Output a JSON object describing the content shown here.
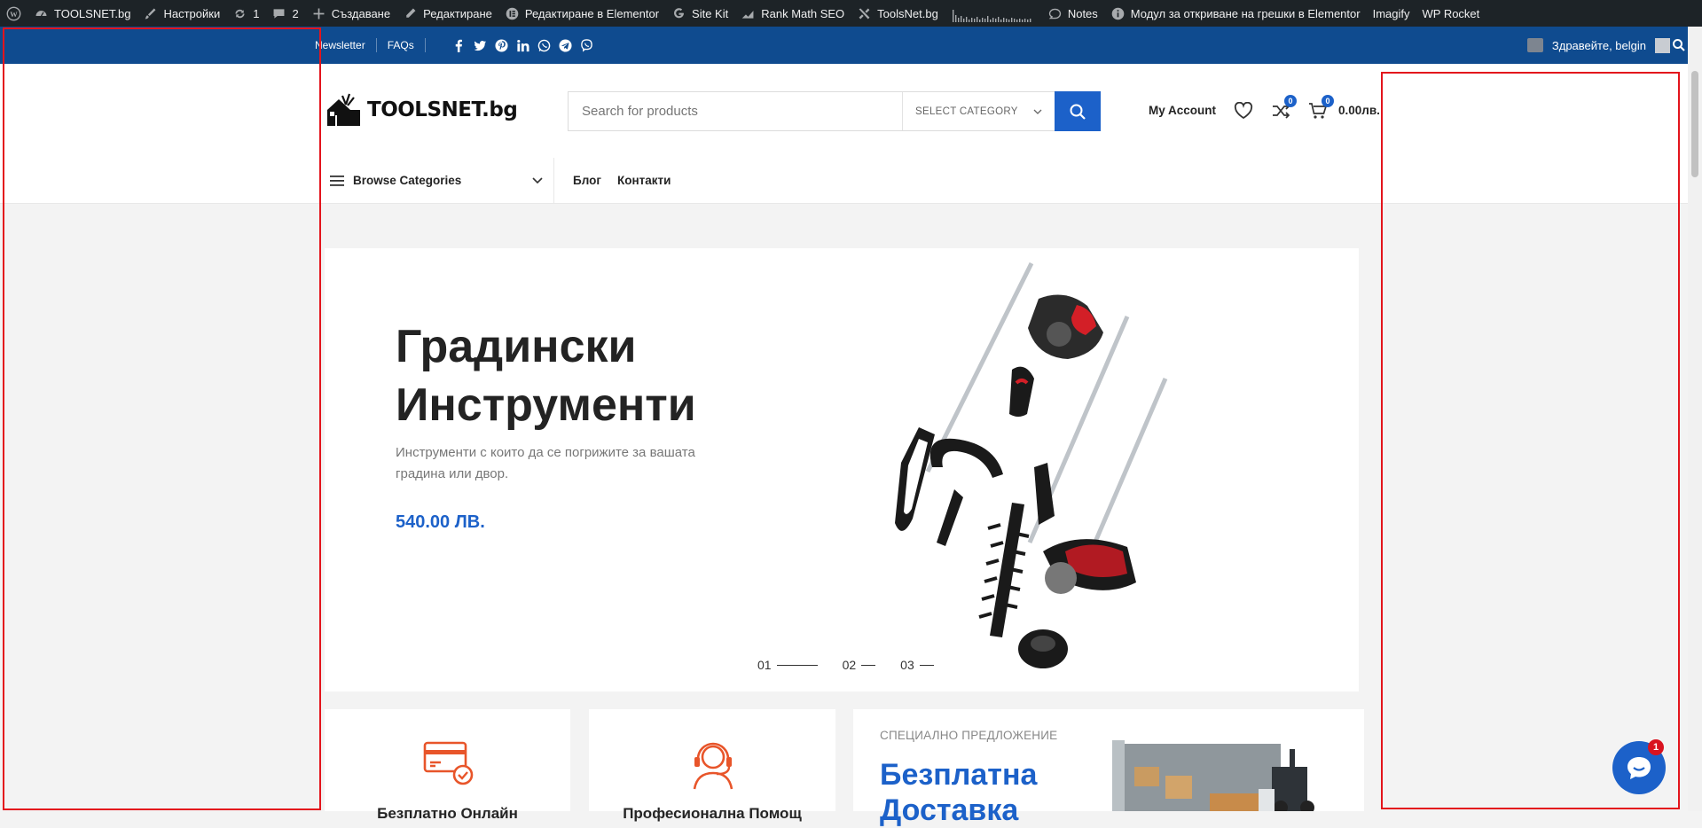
{
  "adminbar": {
    "site_name": "TOOLSNET.bg",
    "settings": "Настройки",
    "updates_count": "1",
    "comments_count": "2",
    "new": "Създаване",
    "edit": "Редактиране",
    "edit_elementor": "Редактиране в Elementor",
    "site_kit": "Site Kit",
    "rank_math": "Rank Math SEO",
    "toolsnet": "ToolsNet.bg",
    "notes": "Notes",
    "debug_mode": "Модул за откриване на грешки в Elementor",
    "imagify": "Imagify",
    "wp_rocket": "WP Rocket"
  },
  "topbar": {
    "newsletter": "Newsletter",
    "faqs": "FAQs",
    "social": [
      "facebook-icon",
      "twitter-icon",
      "pinterest-icon",
      "linkedin-icon",
      "whatsapp-icon",
      "telegram-icon",
      "viber-icon"
    ],
    "howdy": "Здравейте, belgin"
  },
  "header": {
    "logo_text": "TOOLSNET.bg",
    "search_placeholder": "Search for products",
    "category_label": "SELECT CATEGORY",
    "account": "My Account",
    "compare_count": "0",
    "cart_count": "0",
    "cart_total": "0.00лв."
  },
  "nav": {
    "browse": "Browse Categories",
    "items": [
      "Блог",
      "Контакти"
    ]
  },
  "hero": {
    "title_line1": "Градински",
    "title_line2": "Инструменти",
    "subtitle": "Инструменти с които да се погрижите за вашата градина или двор.",
    "price": "540.00 ЛВ.",
    "slides": [
      "01",
      "02",
      "03"
    ]
  },
  "cards": {
    "card1_title": "Безплатно Онлайн",
    "card2_title": "Професионална Помощ",
    "promo_label": "СПЕЦИАЛНО ПРЕДЛОЖЕНИЕ",
    "promo_title_line1": "Безплатна",
    "promo_title_line2": "Доставка"
  },
  "chat": {
    "unread": "1"
  },
  "colors": {
    "accent": "#1c61c9",
    "topbar": "#0f4b8f",
    "adminbar": "#1d2327",
    "annotation": "#e3141c",
    "icon_orange": "#e8552a"
  }
}
